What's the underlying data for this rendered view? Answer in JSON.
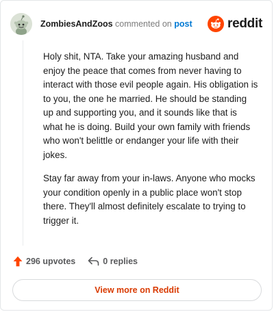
{
  "comment": {
    "username": "ZombiesAndZoos",
    "action_text": "commented on",
    "post_link_text": "post",
    "paragraphs": [
      "Holy shit, NTA. Take your amazing husband and enjoy the peace that comes from never having to interact with those evil people again. His obligation is to you, the one he married. He should be standing up and supporting you, and it sounds like that is what he is doing. Build your own family with friends who won't belittle or endanger your life with their jokes.",
      "Stay far away from your in-laws. Anyone who mocks your condition openly in a public place won't stop there. They'll almost definitely escalate to trying to trigger it."
    ],
    "avatar_icon": "snoo-avatar-icon"
  },
  "brand": {
    "wordmark": "reddit",
    "icon": "reddit-logo-icon",
    "color": "#ff4500"
  },
  "actions": {
    "upvotes_label": "296 upvotes",
    "upvote_icon": "upvote-arrow-icon",
    "upvote_color": "#ff4500",
    "replies_label": "0 replies",
    "reply_icon": "reply-arrow-icon"
  },
  "footer": {
    "view_more_label": "View more on Reddit",
    "accent_color": "#d93a00"
  }
}
